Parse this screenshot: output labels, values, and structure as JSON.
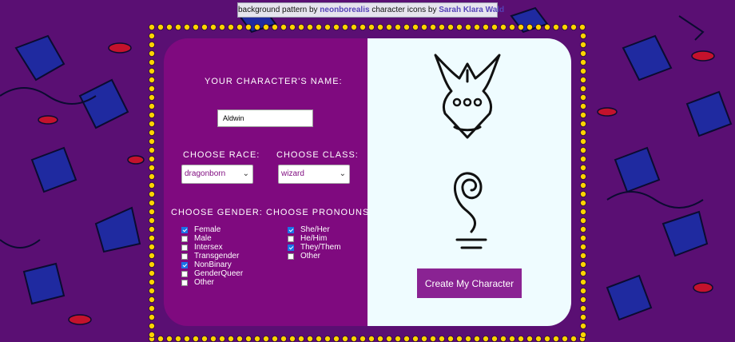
{
  "credit": {
    "prefix": "background pattern by",
    "pattern_author": "neonborealis",
    "middle": "character icons by",
    "icon_author": "Sarah Klara Wald"
  },
  "form": {
    "name_label": "YOUR CHARACTER'S NAME:",
    "name_value": "Aldwin",
    "race_label": "CHOOSE RACE:",
    "race_value": "dragonborn",
    "class_label": "CHOOSE CLASS:",
    "class_value": "wizard",
    "gender_label": "CHOOSE GENDER:",
    "pronouns_label": "CHOOSE PRONOUNS:",
    "genders": [
      {
        "label": "Female",
        "checked": true
      },
      {
        "label": "Male",
        "checked": false
      },
      {
        "label": "Intersex",
        "checked": false
      },
      {
        "label": "Transgender",
        "checked": false
      },
      {
        "label": "NonBinary",
        "checked": true
      },
      {
        "label": "GenderQueer",
        "checked": false
      },
      {
        "label": "Other",
        "checked": false
      }
    ],
    "pronouns": [
      {
        "label": "She/Her",
        "checked": true
      },
      {
        "label": "He/Him",
        "checked": false
      },
      {
        "label": "They/Them",
        "checked": true
      },
      {
        "label": "Other",
        "checked": false
      }
    ]
  },
  "preview": {
    "race_icon": "dragonborn-icon",
    "class_icon": "wizard-icon",
    "button_label": "Create My Character"
  },
  "colors": {
    "panel": "#7f0a7f",
    "preview_bg": "#effcff",
    "button": "#8a2393",
    "dots": "#ffd400",
    "background": "#5a0f73"
  }
}
